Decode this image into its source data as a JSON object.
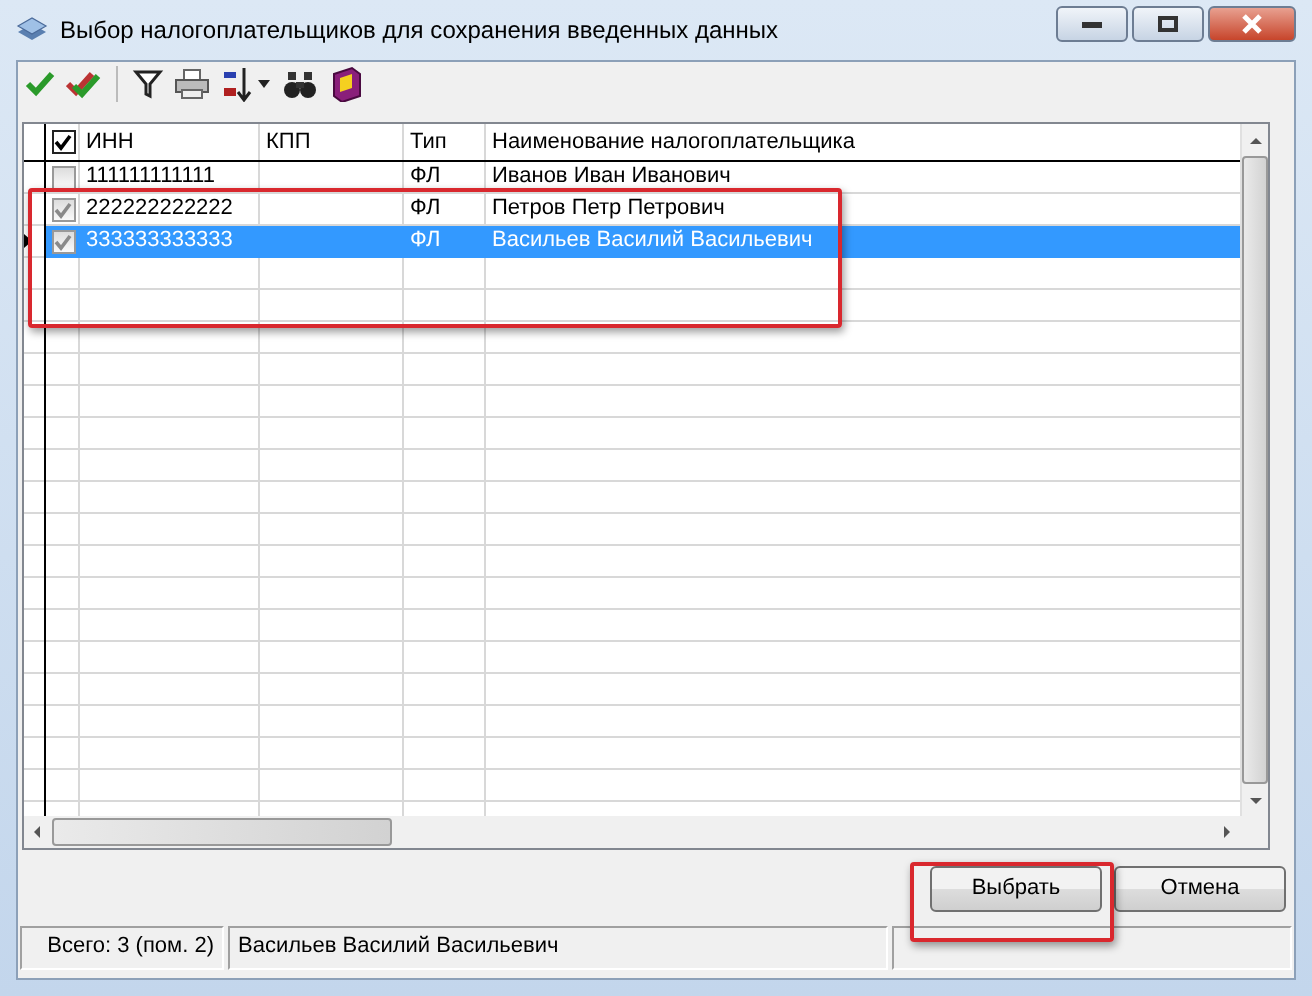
{
  "window": {
    "title": "Выбор налогоплательщиков для сохранения введенных данных"
  },
  "table": {
    "header_checked": true,
    "columns": [
      "ИНН",
      "КПП",
      "Тип",
      "Наименование налогоплательщика"
    ],
    "rows": [
      {
        "checked": false,
        "selected": false,
        "cells": [
          "111111111111",
          "",
          "ФЛ",
          "Иванов Иван Иванович"
        ]
      },
      {
        "checked": true,
        "selected": false,
        "cells": [
          "222222222222",
          "",
          "ФЛ",
          "Петров Петр Петрович"
        ]
      },
      {
        "checked": true,
        "selected": true,
        "cells": [
          "333333333333",
          "",
          "ФЛ",
          "Васильев Василий Васильевич"
        ]
      }
    ]
  },
  "buttons": [
    "Выбрать",
    "Отмена"
  ],
  "status_bar": [
    "Всего: 3 (пом. 2)",
    "Васильев Василий Васильевич"
  ]
}
